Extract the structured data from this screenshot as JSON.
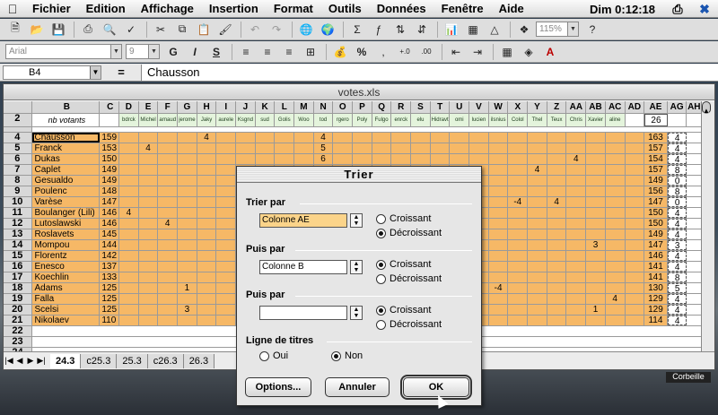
{
  "menubar": {
    "items": [
      "Fichier",
      "Edition",
      "Affichage",
      "Insertion",
      "Format",
      "Outils",
      "Données",
      "Fenêtre",
      "Aide"
    ],
    "clock": "Dim 0:12:18"
  },
  "toolbar": {
    "zoom": "115%",
    "font": "Arial",
    "size": "9"
  },
  "formula": {
    "cell": "B4",
    "eq": "=",
    "value": "Chausson"
  },
  "window": {
    "title": "votes.xls"
  },
  "columns": [
    "B",
    "C",
    "D",
    "E",
    "F",
    "G",
    "H",
    "I",
    "J",
    "K",
    "L",
    "M",
    "N",
    "O",
    "P",
    "Q",
    "R",
    "S",
    "T",
    "U",
    "V",
    "W",
    "X",
    "Y",
    "Z",
    "AA",
    "AB",
    "AC",
    "AD",
    "AE",
    "AG",
    "AH"
  ],
  "header_row": {
    "num": "2",
    "label": "nb votants",
    "names": [
      "bdrck",
      "Michel",
      "arnaud",
      "jerome",
      "Jaky",
      "aurele",
      "Ksgnd",
      "sud",
      "Golis",
      "Woo",
      "tod",
      "rgero",
      "Poly",
      "Fulgo",
      "enrck",
      "elu",
      "Hidravt",
      "omi",
      "lucien",
      "ilsnius",
      "Colol",
      "Thel",
      "Teux",
      "Chris",
      "Xavier",
      "aline"
    ],
    "count": "26"
  },
  "rows": [
    {
      "n": "4",
      "name": "Chausson",
      "c": "159",
      "h": "4",
      "ae": "163",
      "ag": "4"
    },
    {
      "n": "5",
      "name": "Franck",
      "c": "153",
      "e": "4",
      "ae": "157",
      "ag": "4"
    },
    {
      "n": "6",
      "name": "Dukas",
      "c": "150",
      "aa": "4",
      "ae": "154",
      "ag": "4"
    },
    {
      "n": "7",
      "name": "Caplet",
      "c": "149",
      "y": "4",
      "ae": "157",
      "ag": "8"
    },
    {
      "n": "8",
      "name": "Gesualdo",
      "c": "149",
      "ae": "149",
      "ag": "0"
    },
    {
      "n": "9",
      "name": "Poulenc",
      "c": "148",
      "ae": "156",
      "ag": "8"
    },
    {
      "n": "10",
      "name": "Varèse",
      "c": "147",
      "x": "-4",
      "z": "4",
      "ae": "147",
      "ag": "0"
    },
    {
      "n": "11",
      "name": "Boulanger (Lili)",
      "c": "146",
      "d": "4",
      "ae": "150",
      "ag": "4"
    },
    {
      "n": "12",
      "name": "Lutoslawski",
      "c": "146",
      "f": "4",
      "ae": "150",
      "ag": "4"
    },
    {
      "n": "13",
      "name": "Roslavets",
      "c": "145",
      "ae": "149",
      "ag": "4"
    },
    {
      "n": "14",
      "name": "Mompou",
      "c": "144",
      "ab": "3",
      "ae": "147",
      "ag": "3"
    },
    {
      "n": "15",
      "name": "Florentz",
      "c": "142",
      "ae": "146",
      "ag": "4"
    },
    {
      "n": "16",
      "name": "Enesco",
      "c": "137",
      "ae": "141",
      "ag": "4"
    },
    {
      "n": "17",
      "name": "Koechlin",
      "c": "133",
      "ae": "141",
      "ag": "8"
    },
    {
      "n": "18",
      "name": "Adams",
      "c": "125",
      "g": "1",
      "w": "-4",
      "ae": "130",
      "ag": "5"
    },
    {
      "n": "19",
      "name": "Falla",
      "c": "125",
      "ac": "4",
      "ae": "129",
      "ag": "4"
    },
    {
      "n": "20",
      "name": "Scelsi",
      "c": "125",
      "g": "3",
      "ab": "1",
      "ae": "129",
      "ag": "4"
    },
    {
      "n": "21",
      "name": "Nikolaev",
      "c": "110",
      "ae": "114",
      "ag": "4"
    }
  ],
  "empty_rows": [
    "22",
    "23",
    "24"
  ],
  "tabs": [
    "24.3",
    "c25.3",
    "25.3",
    "c26.3",
    "26.3"
  ],
  "trash": "Corbeille",
  "dialog": {
    "title": "Trier",
    "sort_by": "Trier par",
    "sort_by_value": "Colonne AE",
    "then_by": "Puis par",
    "then_by_value": "Colonne B",
    "then_by2": "Puis par",
    "then_by2_value": "",
    "asc": "Croissant",
    "desc": "Décroissant",
    "header_line": "Ligne de titres",
    "yes": "Oui",
    "no": "Non",
    "options": "Options...",
    "cancel": "Annuler",
    "ok": "OK"
  }
}
